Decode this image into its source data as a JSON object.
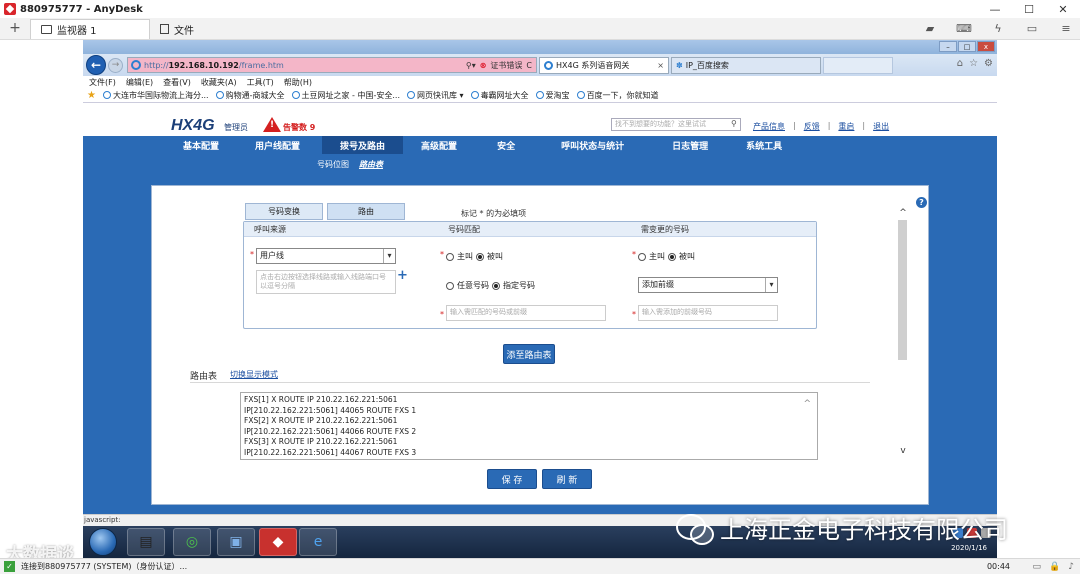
{
  "anydesk": {
    "title": "880975777 - AnyDesk",
    "tab_monitor": "监视器 1",
    "tab_files": "文件",
    "status_text": "连接到880975777 (SYSTEM)（身份认证）...",
    "status_time": "00:44"
  },
  "ie": {
    "url_prefix": "http://",
    "url_host": "192.168.10.192",
    "url_path": "/frame.htm",
    "cert_error": "证书错误",
    "tab_active": "HX4G 系列语音网关",
    "tab_inactive": "IP_百度搜索",
    "menu": [
      "文件(F)",
      "编辑(E)",
      "查看(V)",
      "收藏夹(A)",
      "工具(T)",
      "帮助(H)"
    ],
    "favorites": [
      "大连市华国际物流上海分...",
      "购物通-商城大全",
      "土豆网址之家 - 中国-安全...",
      "网页快讯库 ▾",
      "毒霸网址大全",
      "爱淘宝",
      "百度一下，你就知道"
    ],
    "status_bar": "javascript:"
  },
  "app": {
    "logo": "HX4G",
    "role": "管理员",
    "alarm": "告警数 9",
    "search_placeholder": "找不到想要的功能？这里试试",
    "links": [
      "产品信息",
      "反馈",
      "重启",
      "退出"
    ],
    "main_nav": [
      "基本配置",
      "用户线配置",
      "拨号及路由",
      "高级配置",
      "安全",
      "呼叫状态与统计",
      "日志管理",
      "系统工具"
    ],
    "sub_nav": [
      "号码位图",
      "路由表"
    ]
  },
  "form": {
    "tabs": [
      "号码变换",
      "路由"
    ],
    "required_note": "标记 * 的为必填项",
    "headers": [
      "呼叫来源",
      "号码匹配",
      "需变更的号码"
    ],
    "source_select": "用户线",
    "source_placeholder": "点击右边按钮选择线路或输入线路端口号以逗号分隔",
    "match_radio_a": "主叫",
    "match_radio_b": "被叫",
    "match_any": "任意号码",
    "match_specified": "指定号码",
    "match_placeholder": "输入需匹配的号码或前缀",
    "change_radio_a": "主叫",
    "change_radio_b": "被叫",
    "change_select": "添加前缀",
    "change_placeholder": "输入需添加的前缀号码",
    "add_button": "添至路由表"
  },
  "route_table": {
    "label": "路由表",
    "toggle": "切换显示模式",
    "lines": [
      "FXS[1] X ROUTE IP   210.22.162.221:5061",
      "IP[210.22.162.221:5061] 44065 ROUTE FXS 1",
      "FXS[2] X ROUTE IP   210.22.162.221:5061",
      "IP[210.22.162.221:5061] 44066 ROUTE FXS 2",
      "FXS[3] X ROUTE IP   210.22.162.221:5061",
      "IP[210.22.162.221:5061] 44067 ROUTE FXS 3"
    ],
    "save": "保 存",
    "refresh": "刷 新"
  },
  "taskbar": {
    "date": "2020/1/16"
  },
  "watermark": {
    "left": "大数据谈",
    "right": "上海正金电子科技有限公司"
  }
}
